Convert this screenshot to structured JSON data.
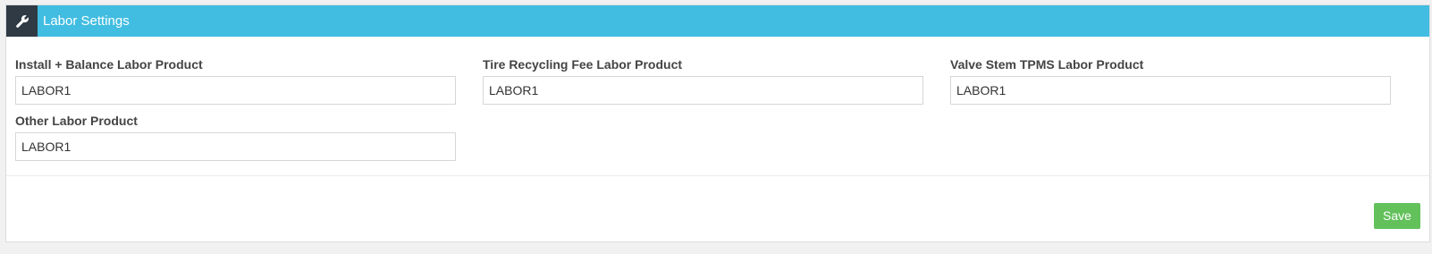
{
  "panel": {
    "title": "Labor Settings",
    "icon": "wrench-icon",
    "header_color": "#41bde1"
  },
  "fields": [
    {
      "label": "Install + Balance Labor Product",
      "value": "LABOR1"
    },
    {
      "label": "Tire Recycling Fee Labor Product",
      "value": "LABOR1"
    },
    {
      "label": "Valve Stem TPMS Labor Product",
      "value": "LABOR1"
    },
    {
      "label": "Other Labor Product",
      "value": "LABOR1"
    }
  ],
  "footer": {
    "save_label": "Save",
    "save_color": "#62c15b"
  }
}
